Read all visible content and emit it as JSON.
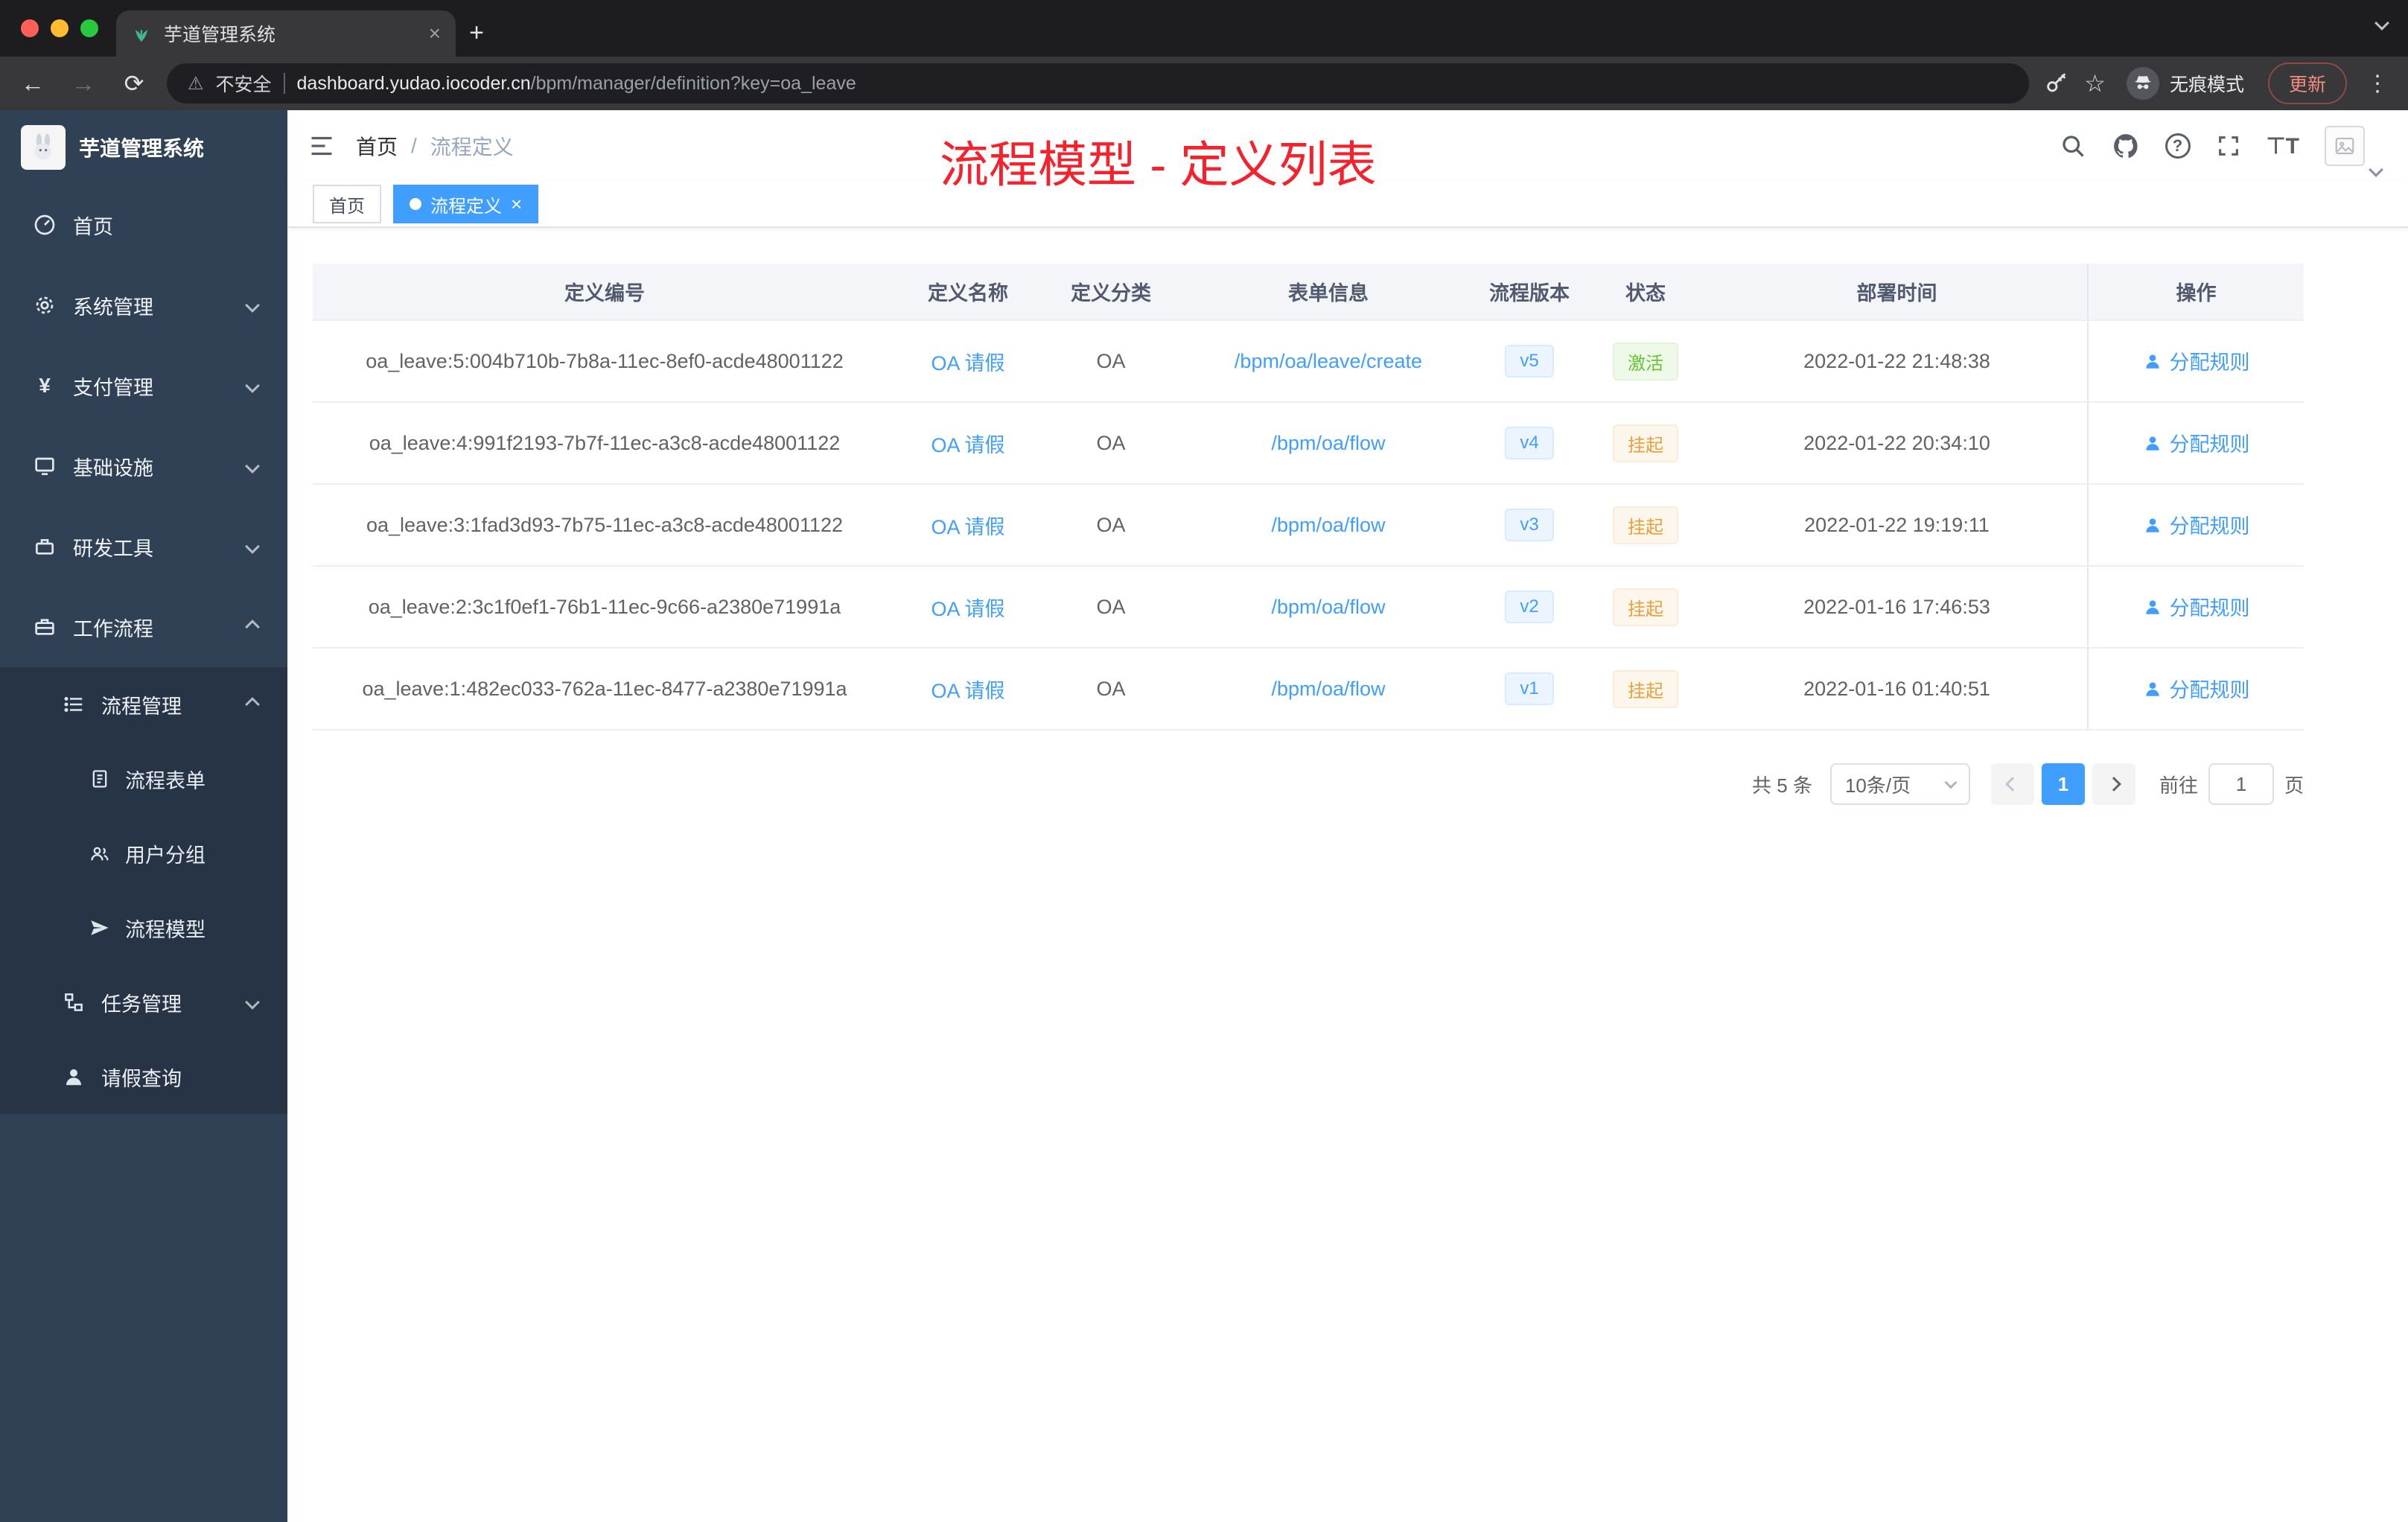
{
  "browser": {
    "tab_title": "芋道管理系统",
    "security_label": "不安全",
    "url_host": "dashboard.yudao.iocoder.cn",
    "url_path": "/bpm/manager/definition?key=oa_leave",
    "incognito_label": "无痕模式",
    "update_label": "更新"
  },
  "sidebar": {
    "app_title": "芋道管理系统",
    "items": [
      {
        "label": "首页"
      },
      {
        "label": "系统管理"
      },
      {
        "label": "支付管理"
      },
      {
        "label": "基础设施"
      },
      {
        "label": "研发工具"
      },
      {
        "label": "工作流程"
      }
    ],
    "workflow": {
      "process_mgmt": "流程管理",
      "children": [
        {
          "label": "流程表单"
        },
        {
          "label": "用户分组"
        },
        {
          "label": "流程模型"
        }
      ],
      "task_mgmt": "任务管理",
      "leave_query": "请假查询"
    }
  },
  "header": {
    "breadcrumb_home": "首页",
    "breadcrumb_separator": "/",
    "breadcrumb_current": "流程定义",
    "annotation": "流程模型 - 定义列表"
  },
  "tags": {
    "home": {
      "label": "首页"
    },
    "active": {
      "label": "流程定义"
    }
  },
  "table": {
    "columns": [
      "定义编号",
      "定义名称",
      "定义分类",
      "表单信息",
      "流程版本",
      "状态",
      "部署时间",
      "操作"
    ],
    "rows": [
      {
        "id": "oa_leave:5:004b710b-7b8a-11ec-8ef0-acde48001122",
        "name": "OA 请假",
        "category": "OA",
        "form": "/bpm/oa/leave/create",
        "version": "v5",
        "status": "激活",
        "status_type": "success",
        "deploy_time": "2022-01-22 21:48:38",
        "action": "分配规则"
      },
      {
        "id": "oa_leave:4:991f2193-7b7f-11ec-a3c8-acde48001122",
        "name": "OA 请假",
        "category": "OA",
        "form": "/bpm/oa/flow",
        "version": "v4",
        "status": "挂起",
        "status_type": "warning",
        "deploy_time": "2022-01-22 20:34:10",
        "action": "分配规则"
      },
      {
        "id": "oa_leave:3:1fad3d93-7b75-11ec-a3c8-acde48001122",
        "name": "OA 请假",
        "category": "OA",
        "form": "/bpm/oa/flow",
        "version": "v3",
        "status": "挂起",
        "status_type": "warning",
        "deploy_time": "2022-01-22 19:19:11",
        "action": "分配规则"
      },
      {
        "id": "oa_leave:2:3c1f0ef1-76b1-11ec-9c66-a2380e71991a",
        "name": "OA 请假",
        "category": "OA",
        "form": "/bpm/oa/flow",
        "version": "v2",
        "status": "挂起",
        "status_type": "warning",
        "deploy_time": "2022-01-16 17:46:53",
        "action": "分配规则"
      },
      {
        "id": "oa_leave:1:482ec033-762a-11ec-8477-a2380e71991a",
        "name": "OA 请假",
        "category": "OA",
        "form": "/bpm/oa/flow",
        "version": "v1",
        "status": "挂起",
        "status_type": "warning",
        "deploy_time": "2022-01-16 01:40:51",
        "action": "分配规则"
      }
    ]
  },
  "pagination": {
    "total": "共 5 条",
    "page_size": "10条/页",
    "current_page": "1",
    "goto_label": "前往",
    "goto_value": "1",
    "page_unit": "页"
  },
  "colors": {
    "accent": "#409eff",
    "success": "#67c23a",
    "warning": "#e6a23c",
    "annotation_red": "#f5222d",
    "sidebar_bg": "#304156",
    "submenu_bg": "#263445"
  }
}
